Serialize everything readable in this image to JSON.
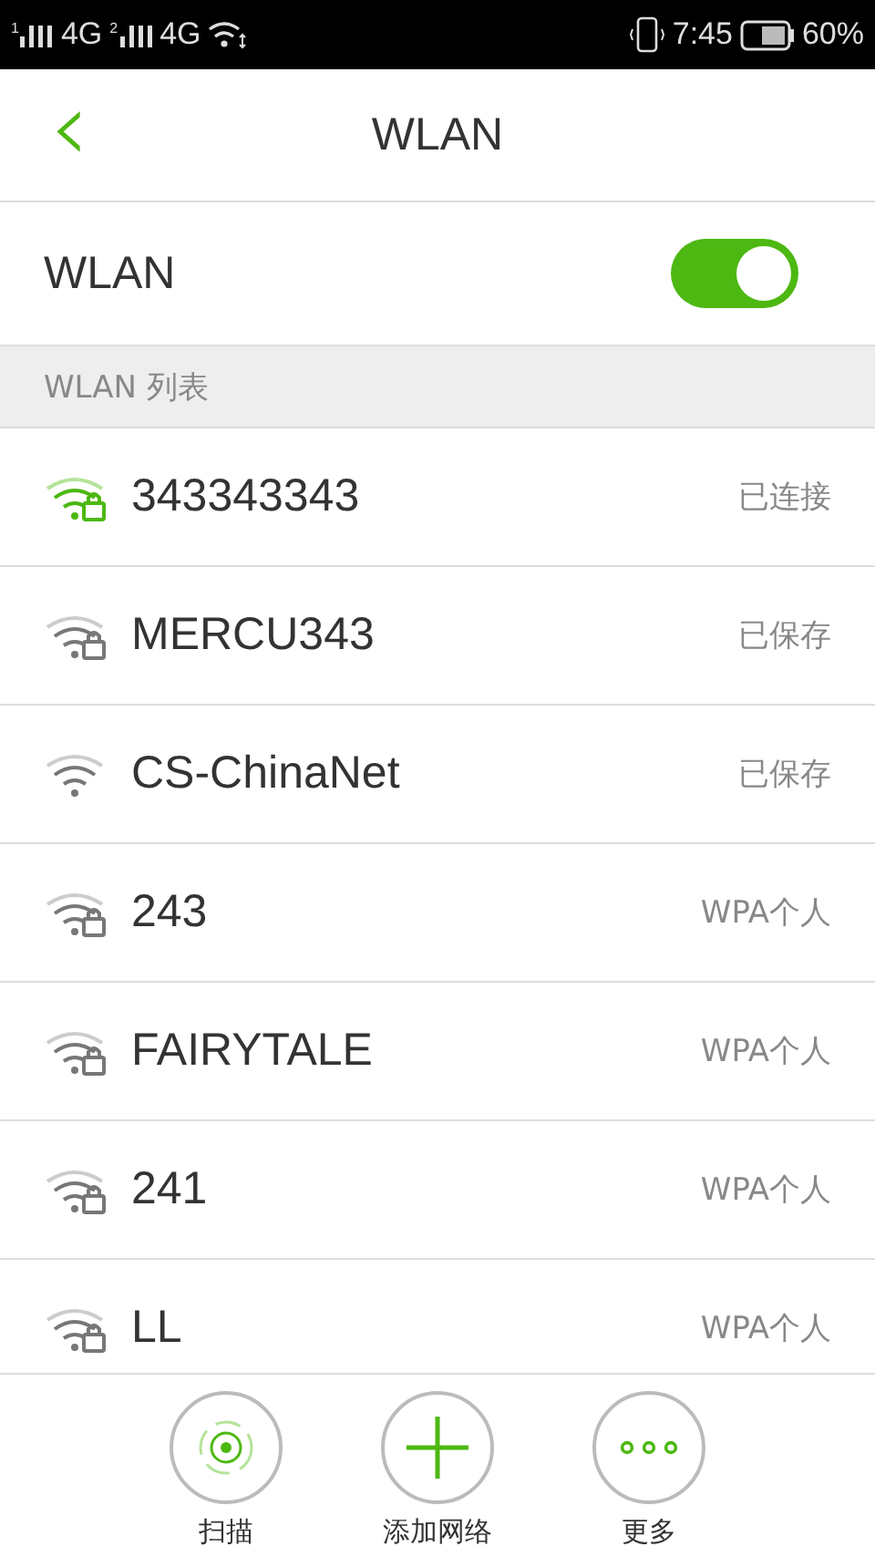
{
  "status_bar": {
    "sims": [
      {
        "slot": "1",
        "network": "4G"
      },
      {
        "slot": "2",
        "network": "4G"
      }
    ],
    "time": "7:45",
    "battery": "60%"
  },
  "header": {
    "back": "‹",
    "title": "WLAN"
  },
  "wlan_switch": {
    "label": "WLAN",
    "on": true
  },
  "section": {
    "title": "WLAN 列表"
  },
  "networks": [
    {
      "name": "343343343",
      "status": "已连接",
      "connected": true,
      "secured": true
    },
    {
      "name": "MERCU343",
      "status": "已保存",
      "connected": false,
      "secured": true
    },
    {
      "name": "CS-ChinaNet",
      "status": "已保存",
      "connected": false,
      "secured": false
    },
    {
      "name": "243",
      "status": "WPA个人",
      "connected": false,
      "secured": true
    },
    {
      "name": "FAIRYTALE",
      "status": "WPA个人",
      "connected": false,
      "secured": true
    },
    {
      "name": "241",
      "status": "WPA个人",
      "connected": false,
      "secured": true
    },
    {
      "name": "LL",
      "status": "WPA个人",
      "connected": false,
      "secured": true
    }
  ],
  "actions": [
    {
      "kind": "scan",
      "label": "扫描"
    },
    {
      "kind": "add",
      "label": "添加网络"
    },
    {
      "kind": "more",
      "label": "更多"
    }
  ]
}
